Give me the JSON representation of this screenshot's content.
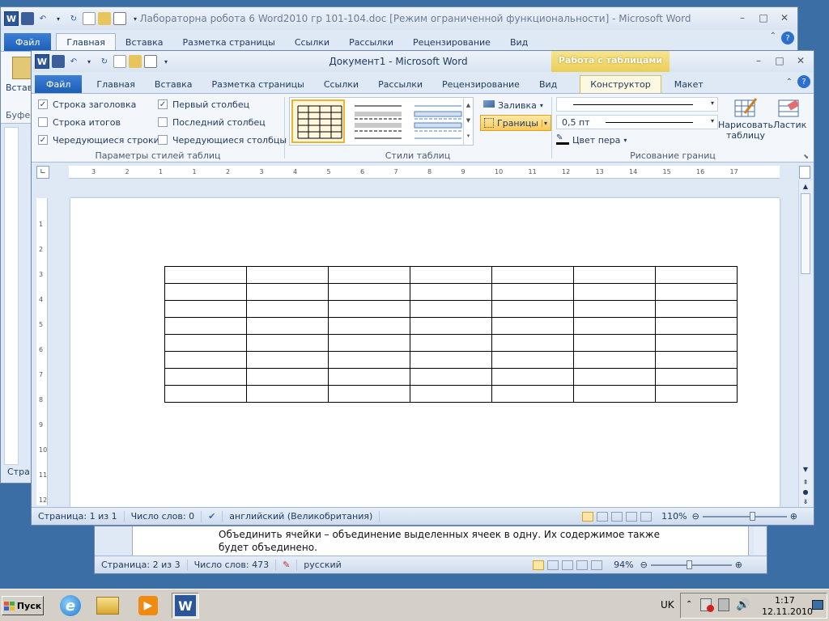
{
  "back_window": {
    "title": "Лабораторна робота 6 Word2010 гр 101-104.doc [Режим ограниченной функциональности]  -  Microsoft Word",
    "tabs": [
      "Файл",
      "Главная",
      "Вставка",
      "Разметка страницы",
      "Ссылки",
      "Рассылки",
      "Рецензирование",
      "Вид"
    ],
    "left_label_insert": "Встав",
    "left_label_buffer": "Буфе",
    "left_label_page": "Стра",
    "doc_text_line1": "Объединить ячейки – объединение выделенных ячеек в одну. Их содержимое также",
    "doc_text_line2": "будет объединено.",
    "status": {
      "page": "Страница: 2 из 3",
      "words": "Число слов: 473",
      "lang": "русский",
      "zoom": "94%"
    }
  },
  "front_window": {
    "title": "Документ1  -  Microsoft Word",
    "context_tab_group": "Работа с таблицами",
    "tabs": [
      "Файл",
      "Главная",
      "Вставка",
      "Разметка страницы",
      "Ссылки",
      "Рассылки",
      "Рецензирование",
      "Вид",
      "Конструктор",
      "Макет"
    ],
    "active_tab": "Конструктор",
    "style_options": {
      "header_row": "Строка заголовка",
      "total_row": "Строка итогов",
      "banded_rows": "Чередующиеся строки",
      "first_column": "Первый столбец",
      "last_column": "Последний столбец",
      "banded_columns": "Чередующиеся столбцы",
      "checked": {
        "header_row": true,
        "total_row": false,
        "banded_rows": true,
        "first_column": true,
        "last_column": false,
        "banded_columns": false
      },
      "group_label": "Параметры стилей таблиц"
    },
    "table_styles": {
      "group_label": "Стили таблиц",
      "shading": "Заливка",
      "borders": "Границы"
    },
    "draw_borders": {
      "pen_weight": "0,5 пт",
      "pen_color": "Цвет пера",
      "draw_table": "Нарисовать таблицу",
      "draw_table_line1": "Нарисовать",
      "draw_table_line2": "таблицу",
      "eraser": "Ластик",
      "group_label": "Рисование границ"
    },
    "ruler_numbers": [
      "3",
      "2",
      "1",
      "1",
      "2",
      "3",
      "4",
      "5",
      "6",
      "7",
      "8",
      "9",
      "10",
      "11",
      "12",
      "13",
      "14",
      "15",
      "16",
      "17"
    ],
    "vruler_numbers": [
      "1",
      "2",
      "3",
      "4",
      "5",
      "6",
      "7",
      "8",
      "9",
      "10",
      "11",
      "12"
    ],
    "table": {
      "rows": 8,
      "cols": 7
    },
    "status": {
      "page": "Страница: 1 из 1",
      "words": "Число слов: 0",
      "lang": "английский (Великобритания)",
      "zoom": "110%"
    }
  },
  "taskbar": {
    "start": "Пуск",
    "lang": "UK",
    "time": "1:17",
    "date": "12.11.2010"
  },
  "colors": {
    "desktop": "#3a6ea5",
    "file_tab": "#2a6bc5",
    "context_tab": "#f2d86b",
    "ribbon": "#f3f7fc"
  }
}
